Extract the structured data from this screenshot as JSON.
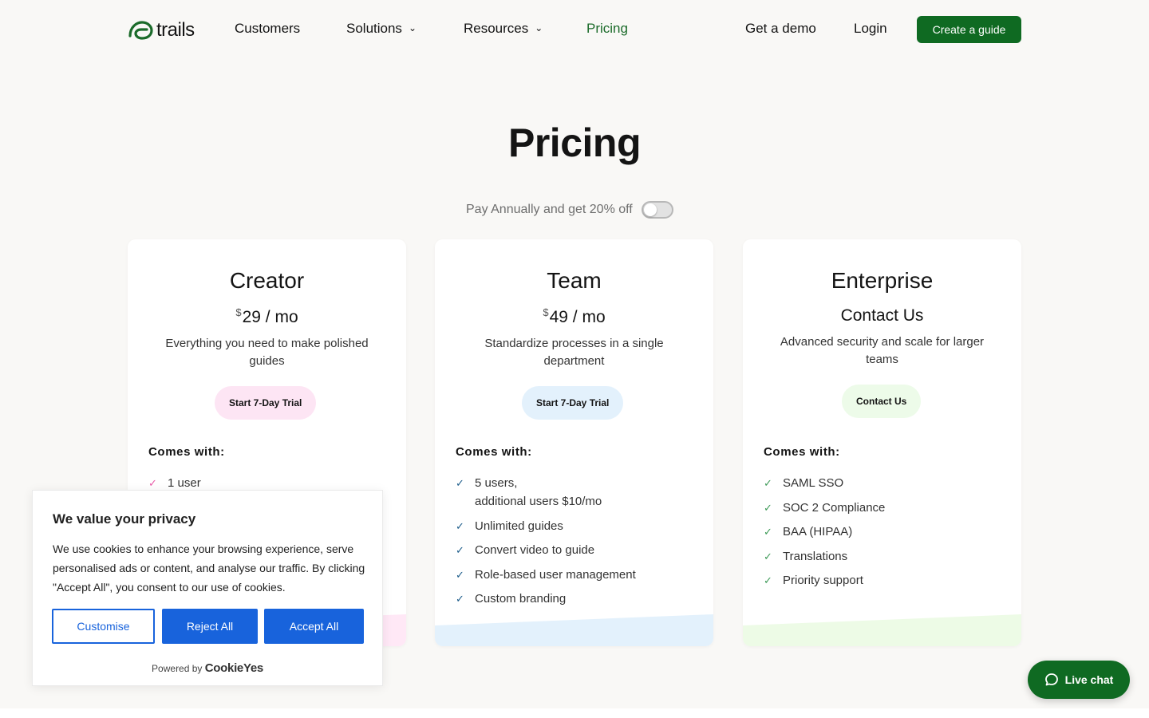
{
  "nav": {
    "logo_text": "trails",
    "items": [
      {
        "label": "Customers"
      },
      {
        "label": "Solutions",
        "chevron": "⌄"
      },
      {
        "label": "Resources",
        "chevron": "⌄"
      },
      {
        "label": "Pricing"
      }
    ],
    "demo": "Get a demo",
    "login": "Login",
    "create": "Create a guide"
  },
  "hero": {
    "title": "Pricing",
    "toggle_label": "Pay Annually and get 20% off"
  },
  "plans": [
    {
      "name": "Creator",
      "currency": "$",
      "price": "29 / mo",
      "description": "Everything you need to make polished guides",
      "cta": "Start 7-Day Trial",
      "cta_color": "#fde5f4",
      "accent": "#ffe8f6",
      "check_color": "#e95ba9",
      "comes_with": "Comes with:",
      "features": [
        "1 user"
      ]
    },
    {
      "name": "Team",
      "currency": "$",
      "price": "49 / mo",
      "description": "Standardize processes in a single department",
      "cta": "Start 7-Day Trial",
      "cta_color": "#e3f1fc",
      "accent": "#e3f1fc",
      "check_color": "#1c5c8a",
      "comes_with": "Comes with:",
      "features": [
        "5 users,",
        "additional users $10/mo",
        "Unlimited guides",
        "Convert video to guide",
        "Role-based user management",
        "Custom branding"
      ]
    },
    {
      "name": "Enterprise",
      "price_text": "Contact Us",
      "description": "Advanced security and scale for larger teams",
      "cta": "Contact Us",
      "cta_color": "#edfbe9",
      "accent": "#edfbe6",
      "check_color": "#3d9a57",
      "comes_with": "Comes with:",
      "features": [
        "SAML SSO",
        "SOC 2 Compliance",
        "BAA (HIPAA)",
        "Translations",
        "Priority support"
      ]
    }
  ],
  "cookie": {
    "title": "We value your privacy",
    "text": "We use cookies to enhance your browsing experience, serve personalised ads or content, and analyse our traffic. By clicking \"Accept All\", you consent to our use of cookies.",
    "customise": "Customise",
    "reject": "Reject All",
    "accept": "Accept All",
    "powered_by": "Powered by",
    "brand": "CookieYes"
  },
  "chat": {
    "label": "Live chat",
    "icon": "chat-bubble-icon"
  },
  "colors": {
    "brand_green": "#0f6a22",
    "active_nav": "#1b6b2a",
    "cookie_blue": "#1863dc"
  }
}
